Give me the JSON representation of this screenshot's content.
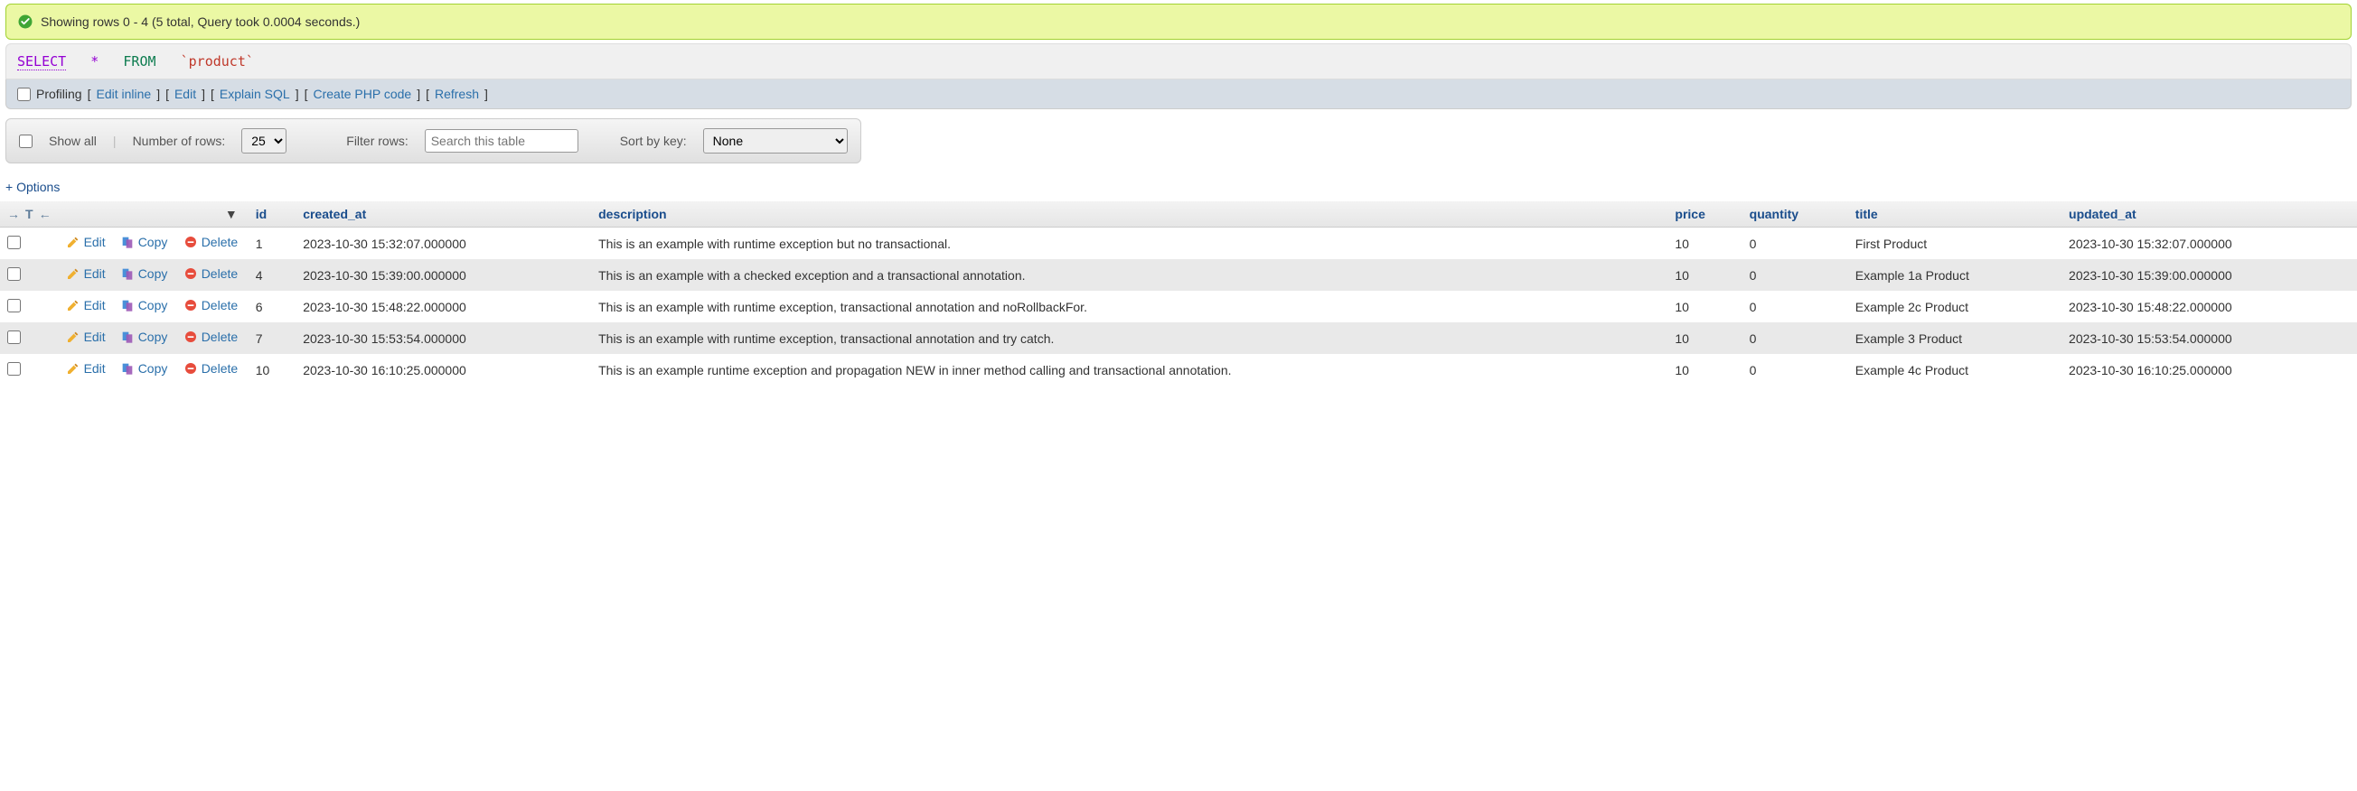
{
  "success": {
    "text": "Showing rows 0 - 4 (5 total, Query took 0.0004 seconds.)"
  },
  "sql": {
    "select": "SELECT",
    "star": "*",
    "from": "FROM",
    "ident": "`product`"
  },
  "actions": {
    "profiling": "Profiling",
    "edit_inline": "Edit inline",
    "edit": "Edit",
    "explain": "Explain SQL",
    "php": "Create PHP code",
    "refresh": "Refresh"
  },
  "controls": {
    "show_all": "Show all",
    "rows_label": "Number of rows:",
    "rows_value": "25",
    "filter_label": "Filter rows:",
    "filter_placeholder": "Search this table",
    "sort_label": "Sort by key:",
    "sort_value": "None"
  },
  "options_link": "+ Options",
  "columns": {
    "id": "id",
    "created_at": "created_at",
    "description": "description",
    "price": "price",
    "quantity": "quantity",
    "title": "title",
    "updated_at": "updated_at"
  },
  "row_labels": {
    "edit": "Edit",
    "copy": "Copy",
    "delete": "Delete"
  },
  "rows": [
    {
      "id": "1",
      "created_at": "2023-10-30 15:32:07.000000",
      "description": "This is an example with runtime exception but no transactional.",
      "price": "10",
      "quantity": "0",
      "title": "First Product",
      "updated_at": "2023-10-30 15:32:07.000000"
    },
    {
      "id": "4",
      "created_at": "2023-10-30 15:39:00.000000",
      "description": "This is an example with a checked exception and a transactional annotation.",
      "price": "10",
      "quantity": "0",
      "title": "Example 1a Product",
      "updated_at": "2023-10-30 15:39:00.000000"
    },
    {
      "id": "6",
      "created_at": "2023-10-30 15:48:22.000000",
      "description": "This is an example with runtime exception, transactional annotation and noRollbackFor.",
      "price": "10",
      "quantity": "0",
      "title": "Example 2c Product",
      "updated_at": "2023-10-30 15:48:22.000000"
    },
    {
      "id": "7",
      "created_at": "2023-10-30 15:53:54.000000",
      "description": "This is an example with runtime exception, transactional annotation and try catch.",
      "price": "10",
      "quantity": "0",
      "title": "Example 3 Product",
      "updated_at": "2023-10-30 15:53:54.000000"
    },
    {
      "id": "10",
      "created_at": "2023-10-30 16:10:25.000000",
      "description": "This is an example runtime exception and propagation NEW in inner method calling and transactional annotation.",
      "price": "10",
      "quantity": "0",
      "title": "Example 4c Product",
      "updated_at": "2023-10-30 16:10:25.000000"
    }
  ]
}
